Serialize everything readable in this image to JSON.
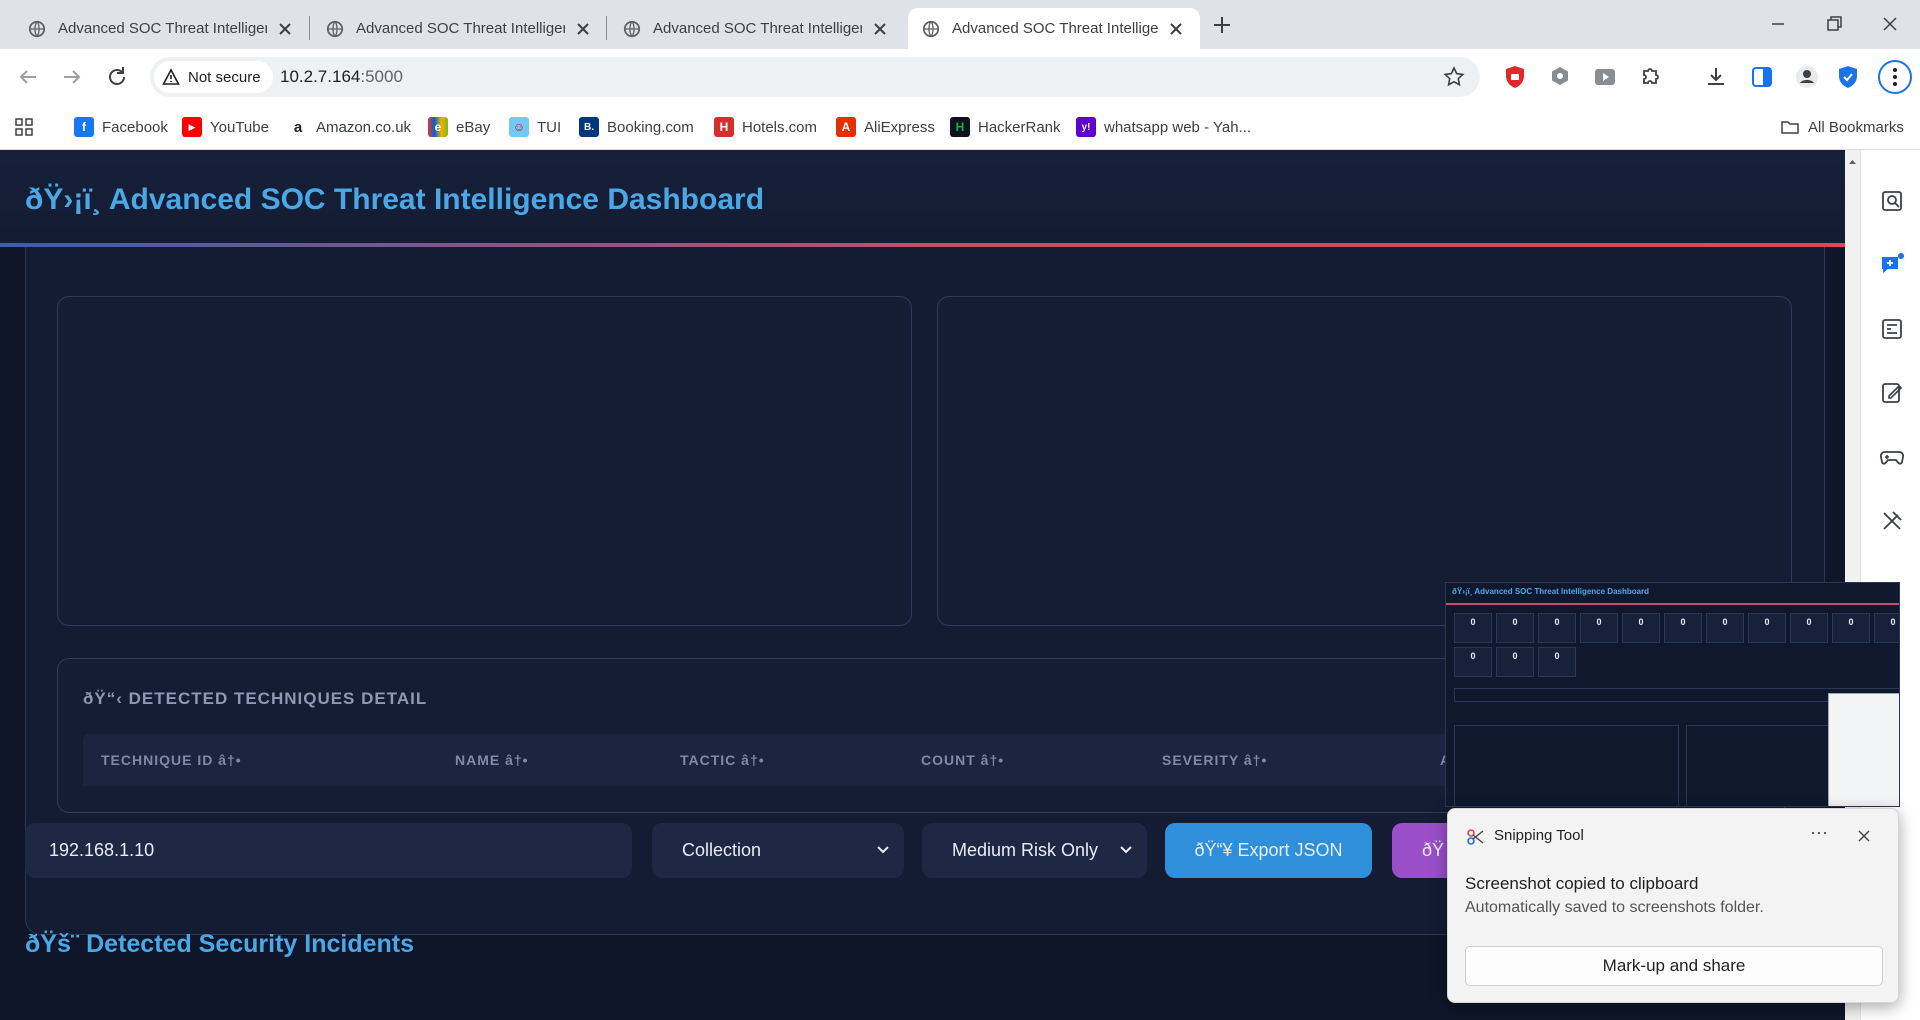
{
  "browser": {
    "tabs": [
      {
        "title": "Advanced SOC Threat Intelligence Dashboard"
      },
      {
        "title": "Advanced SOC Threat Intelligence Dashboard"
      },
      {
        "title": "Advanced SOC Threat Intelligence Dashboard"
      },
      {
        "title": "Advanced SOC Threat Intelligence Dashboard"
      }
    ],
    "security_chip": "Not secure",
    "url_host": "10.2.7.164",
    "url_port": ":5000",
    "bookmarks": [
      {
        "label": "Facebook",
        "icon": "facebook-icon",
        "color": "#1877f2",
        "glyph": "f"
      },
      {
        "label": "YouTube",
        "icon": "youtube-icon",
        "color": "#ff0000",
        "glyph": "▶"
      },
      {
        "label": "Amazon.co.uk",
        "icon": "amazon-icon",
        "color": "#222222",
        "glyph": "a"
      },
      {
        "label": "eBay",
        "icon": "ebay-icon",
        "color": "#e53238",
        "glyph": "e"
      },
      {
        "label": "TUI",
        "icon": "tui-icon",
        "color": "#70cbf4",
        "glyph": "☺"
      },
      {
        "label": "Booking.com",
        "icon": "booking-icon",
        "color": "#003580",
        "glyph": "B."
      },
      {
        "label": "Hotels.com",
        "icon": "hotels-icon",
        "color": "#d32f2f",
        "glyph": "H"
      },
      {
        "label": "AliExpress",
        "icon": "aliexpress-icon",
        "color": "#e62e04",
        "glyph": "A"
      },
      {
        "label": "HackerRank",
        "icon": "hackerrank-icon",
        "color": "#1ba94c",
        "glyph": "H"
      },
      {
        "label": "whatsapp web - Yah...",
        "icon": "yahoo-icon",
        "color": "#6001d2",
        "glyph": "y!"
      }
    ],
    "all_bookmarks": "All Bookmarks"
  },
  "app": {
    "title": "ðŸ›¡ï¸ Advanced SOC Threat Intelligence Dashboard",
    "techniques": {
      "title": "ðŸ“‹ DETECTED TECHNIQUES DETAIL",
      "columns": [
        "TECHNIQUE ID â†•",
        "NAME â†•",
        "TACTIC â†•",
        "COUNT â†•",
        "SEVERITY â†•",
        "A"
      ]
    },
    "controls": {
      "ip_value": "192.168.1.10",
      "tactic_selected": "Collection",
      "risk_selected": "Medium Risk Only",
      "export_json": "ðŸ“¥ Export JSON",
      "purple_button": "ðŸ"
    },
    "incidents_heading": "ðŸš¨ Detected Security Incidents"
  },
  "snipping": {
    "thumbnail": {
      "title": "ðŸ›¡ï¸ Advanced SOC Threat Intelligence Dashboard",
      "stat_values": [
        "0",
        "0",
        "0",
        "0",
        "0",
        "0",
        "0",
        "0",
        "0",
        "0",
        "0",
        "0",
        "0",
        "0"
      ]
    },
    "app_name": "Snipping Tool",
    "message": "Screenshot copied to clipboard",
    "submessage": "Automatically saved to screenshots folder.",
    "action": "Mark-up and share"
  }
}
